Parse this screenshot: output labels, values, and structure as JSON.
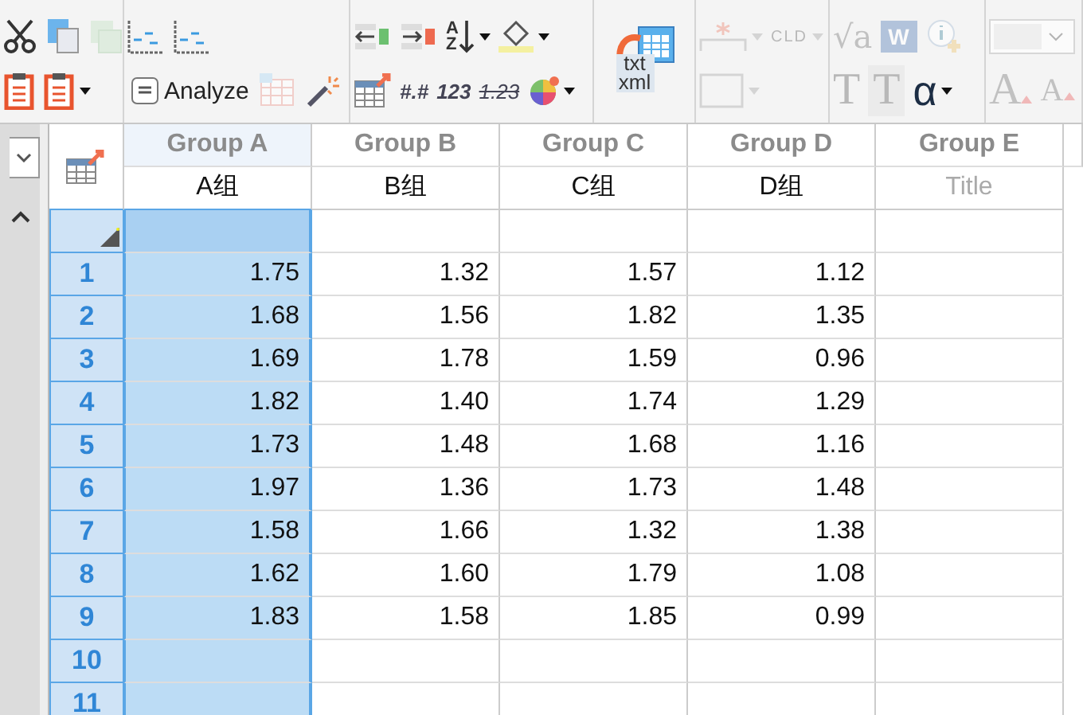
{
  "ribbon": {
    "groups": [
      {
        "rows": [
          [
            {
              "kind": "scissors",
              "disabled": false,
              "dropdown": false
            },
            {
              "kind": "copy",
              "disabled": false,
              "dropdown": false
            },
            {
              "kind": "pages",
              "disabled": true,
              "dropdown": false
            }
          ],
          [
            {
              "kind": "clipboard",
              "disabled": false,
              "dropdown": false
            },
            {
              "kind": "clipboard",
              "disabled": false,
              "dropdown": true
            }
          ]
        ]
      },
      {
        "rows": [
          [
            {
              "kind": "bars",
              "disabled": false,
              "dropdown": false
            },
            {
              "kind": "bars",
              "disabled": false,
              "dropdown": false
            }
          ],
          [
            {
              "kind": "analyze",
              "text": "Analyze",
              "disabled": false,
              "dropdown": false
            },
            {
              "kind": "grid",
              "disabled": true,
              "dropdown": false
            },
            {
              "kind": "wand",
              "disabled": false,
              "dropdown": false
            }
          ]
        ]
      },
      {
        "rows": [
          [
            {
              "kind": "move-left",
              "disabled": false,
              "dropdown": false
            },
            {
              "kind": "move-right",
              "disabled": false,
              "dropdown": false
            },
            {
              "kind": "sort",
              "text": "AZ",
              "disabled": false,
              "dropdown": true
            },
            {
              "kind": "bucket",
              "disabled": false,
              "dropdown": true
            }
          ],
          [
            {
              "kind": "table",
              "disabled": false,
              "dropdown": false
            },
            {
              "kind": "number",
              "text": "#.#",
              "disabled": false,
              "dropdown": false
            },
            {
              "kind": "count",
              "text": "123",
              "disabled": false,
              "dropdown": false
            },
            {
              "kind": "strike",
              "text": "1.23",
              "disabled": false,
              "dropdown": false
            },
            {
              "kind": "wheel",
              "disabled": false,
              "dropdown": true
            }
          ]
        ]
      },
      {
        "rows": [
          [
            {
              "kind": "import",
              "text": "txt xml",
              "disabled": false,
              "dropdown": false
            }
          ]
        ]
      },
      {
        "rows": [
          [
            {
              "kind": "star-line",
              "disabled": true,
              "dropdown": true
            },
            {
              "kind": "cld",
              "text": "CLD",
              "disabled": true,
              "dropdown": true
            }
          ],
          [
            {
              "kind": "rect",
              "disabled": true,
              "dropdown": true
            }
          ]
        ]
      },
      {
        "rows": [
          [
            {
              "kind": "root",
              "text": "√a",
              "disabled": true,
              "dropdown": false
            },
            {
              "kind": "word",
              "text": "W",
              "disabled": true,
              "dropdown": false
            },
            {
              "kind": "info",
              "disabled": true,
              "dropdown": false
            }
          ],
          [
            {
              "kind": "letter",
              "text": "T",
              "disabled": true,
              "dropdown": false
            },
            {
              "kind": "letter-box",
              "text": "T",
              "disabled": true,
              "dropdown": false
            },
            {
              "kind": "alpha",
              "text": "α",
              "disabled": false,
              "dropdown": true
            }
          ]
        ]
      },
      {
        "rows": [
          [
            {
              "kind": "font-field",
              "disabled": true,
              "dropdown": true
            }
          ],
          [
            {
              "kind": "grow",
              "text": "A",
              "disabled": true,
              "dropdown": false
            },
            {
              "kind": "shrink",
              "text": "A",
              "disabled": true,
              "dropdown": false
            }
          ]
        ]
      }
    ]
  },
  "table": {
    "columns": [
      {
        "title": "Group A",
        "subtitle": "A组",
        "selected": true
      },
      {
        "title": "Group B",
        "subtitle": "B组",
        "selected": false
      },
      {
        "title": "Group C",
        "subtitle": "C组",
        "selected": false
      },
      {
        "title": "Group D",
        "subtitle": "D组",
        "selected": false
      },
      {
        "title": "Group E",
        "placeholder": "Title",
        "selected": false
      }
    ],
    "rows": [
      {
        "number": "1",
        "values": [
          "1.75",
          "1.32",
          "1.57",
          "1.12"
        ]
      },
      {
        "number": "2",
        "values": [
          "1.68",
          "1.56",
          "1.82",
          "1.35"
        ]
      },
      {
        "number": "3",
        "values": [
          "1.69",
          "1.78",
          "1.59",
          "0.96"
        ]
      },
      {
        "number": "4",
        "values": [
          "1.82",
          "1.40",
          "1.74",
          "1.29"
        ]
      },
      {
        "number": "5",
        "values": [
          "1.73",
          "1.48",
          "1.68",
          "1.16"
        ]
      },
      {
        "number": "6",
        "values": [
          "1.97",
          "1.36",
          "1.73",
          "1.48"
        ]
      },
      {
        "number": "7",
        "values": [
          "1.58",
          "1.66",
          "1.32",
          "1.38"
        ]
      },
      {
        "number": "8",
        "values": [
          "1.62",
          "1.60",
          "1.79",
          "1.08"
        ]
      },
      {
        "number": "9",
        "values": [
          "1.83",
          "1.58",
          "1.85",
          "0.99"
        ]
      },
      {
        "number": "10",
        "values": []
      },
      {
        "number": "11",
        "values": []
      }
    ]
  }
}
